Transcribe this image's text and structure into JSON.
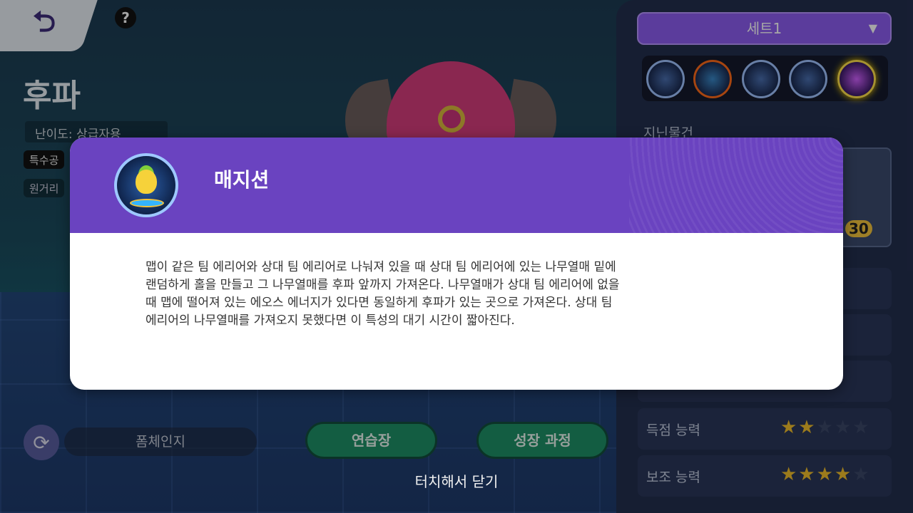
{
  "header": {
    "back_icon": "back-arrow-icon",
    "help_label": "?"
  },
  "pokemon": {
    "name": "후파",
    "difficulty": "난이도: 상급자용",
    "tags": [
      "특수공",
      "원거리"
    ]
  },
  "bottom_bar": {
    "form_label": "폼체인지",
    "practice_button": "연습장",
    "growth_button": "성장 과정",
    "touch_close": "터치해서 닫기"
  },
  "right_panel": {
    "set_label": "세트1",
    "caret": "▼",
    "held_items_label": "지닌물건",
    "item_level": "30",
    "stats": [
      {
        "label": "득점 능력",
        "stars_on": "★★",
        "stars_off": "★★★"
      },
      {
        "label": "보조 능력",
        "stars_on": "★★★★",
        "stars_off": "★"
      }
    ]
  },
  "modal": {
    "title": "매지션",
    "description": "맵이 같은 팀 에리어와 상대 팀 에리어로 나눠져 있을 때 상대 팀 에리어에 있는 나무열매 밑에\n랜덤하게 홀을 만들고 그 나무열매를 후파 앞까지 가져온다. 나무열매가 상대 팀 에리어에 없을\n때 맵에 떨어져 있는 에오스 에너지가 있다면 동일하게 후파가 있는 곳으로 가져온다. 상대 팀\n에리어의 나무열매를 가져오지 못했다면 이 특성의 대기 시간이 짧아진다.",
    "icon": "magician-ability-icon"
  },
  "colors": {
    "modal_header": "#6a43c0",
    "dropdown": "#8c5df0",
    "button_green": "#1e8f66",
    "star": "#f0bd2b"
  }
}
